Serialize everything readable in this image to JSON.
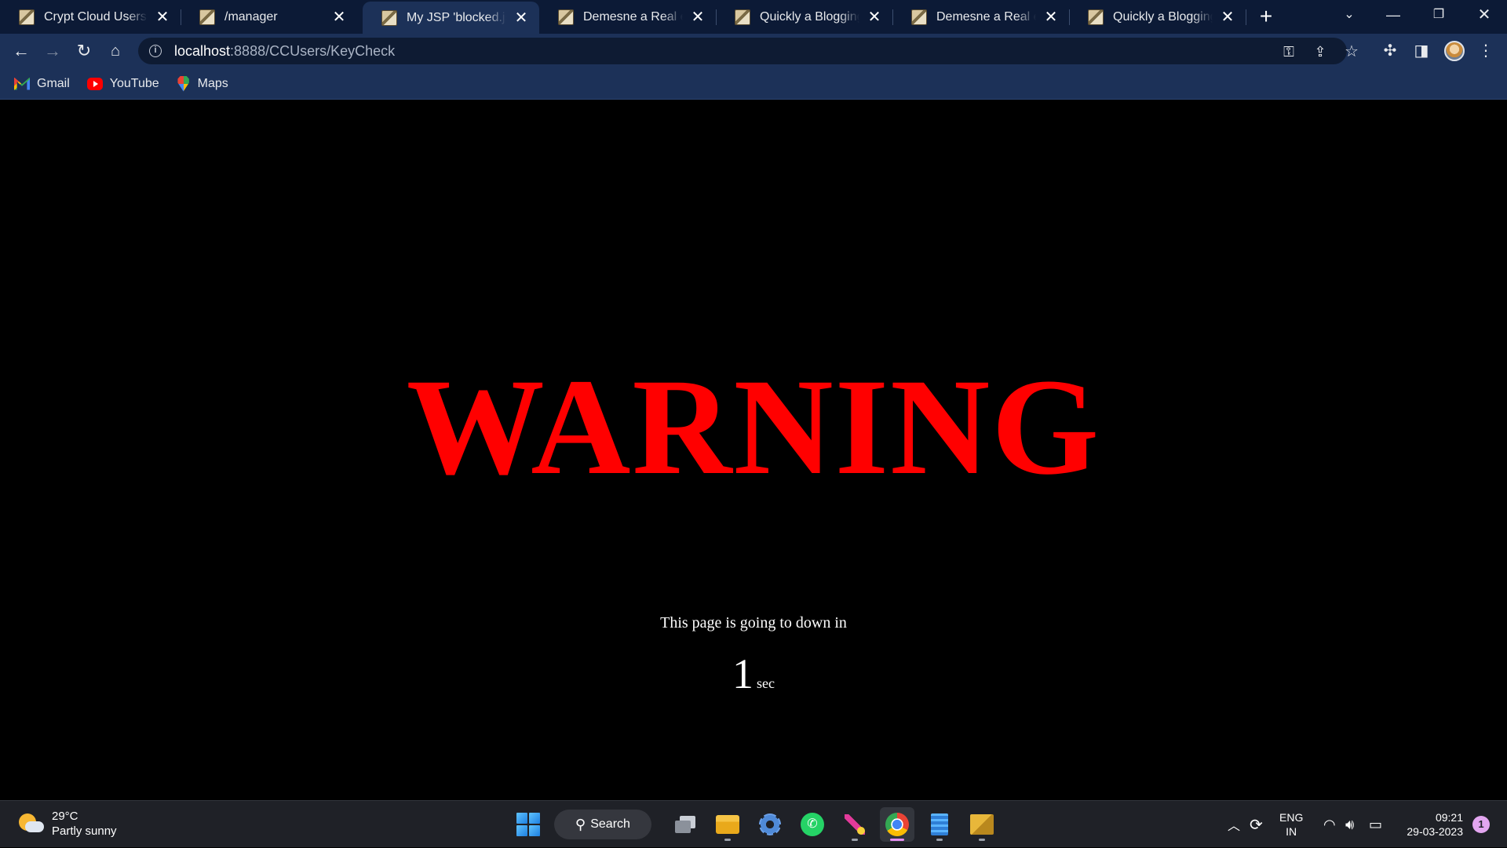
{
  "browser": {
    "tabs": [
      {
        "title": "Crypt Cloud Users",
        "active": false
      },
      {
        "title": "/manager",
        "active": false
      },
      {
        "title": "My JSP 'blocked.jsp' s",
        "active": true
      },
      {
        "title": "Demesne a Real estat",
        "active": false
      },
      {
        "title": "Quickly a Blogging Ca",
        "active": false
      },
      {
        "title": "Demesne a Real estat",
        "active": false
      },
      {
        "title": "Quickly a Blogging Ca",
        "active": false
      }
    ],
    "url_host": "localhost",
    "url_rest": ":8888/CCUsers/KeyCheck",
    "bookmarks": [
      {
        "label": "Gmail",
        "icon": "gmail-icon"
      },
      {
        "label": "YouTube",
        "icon": "youtube-icon"
      },
      {
        "label": "Maps",
        "icon": "maps-icon"
      }
    ]
  },
  "page": {
    "heading": "WARNING",
    "message": "This page is going to down in",
    "countdown_value": "1",
    "countdown_unit": "sec",
    "colors": {
      "heading": "#ff0000",
      "background": "#000000",
      "text": "#ffffff"
    }
  },
  "taskbar": {
    "weather_temp": "29°C",
    "weather_desc": "Partly sunny",
    "search_label": "Search",
    "language_top": "ENG",
    "language_bottom": "IN",
    "time": "09:21",
    "date": "29-03-2023",
    "notification_count": "1"
  }
}
